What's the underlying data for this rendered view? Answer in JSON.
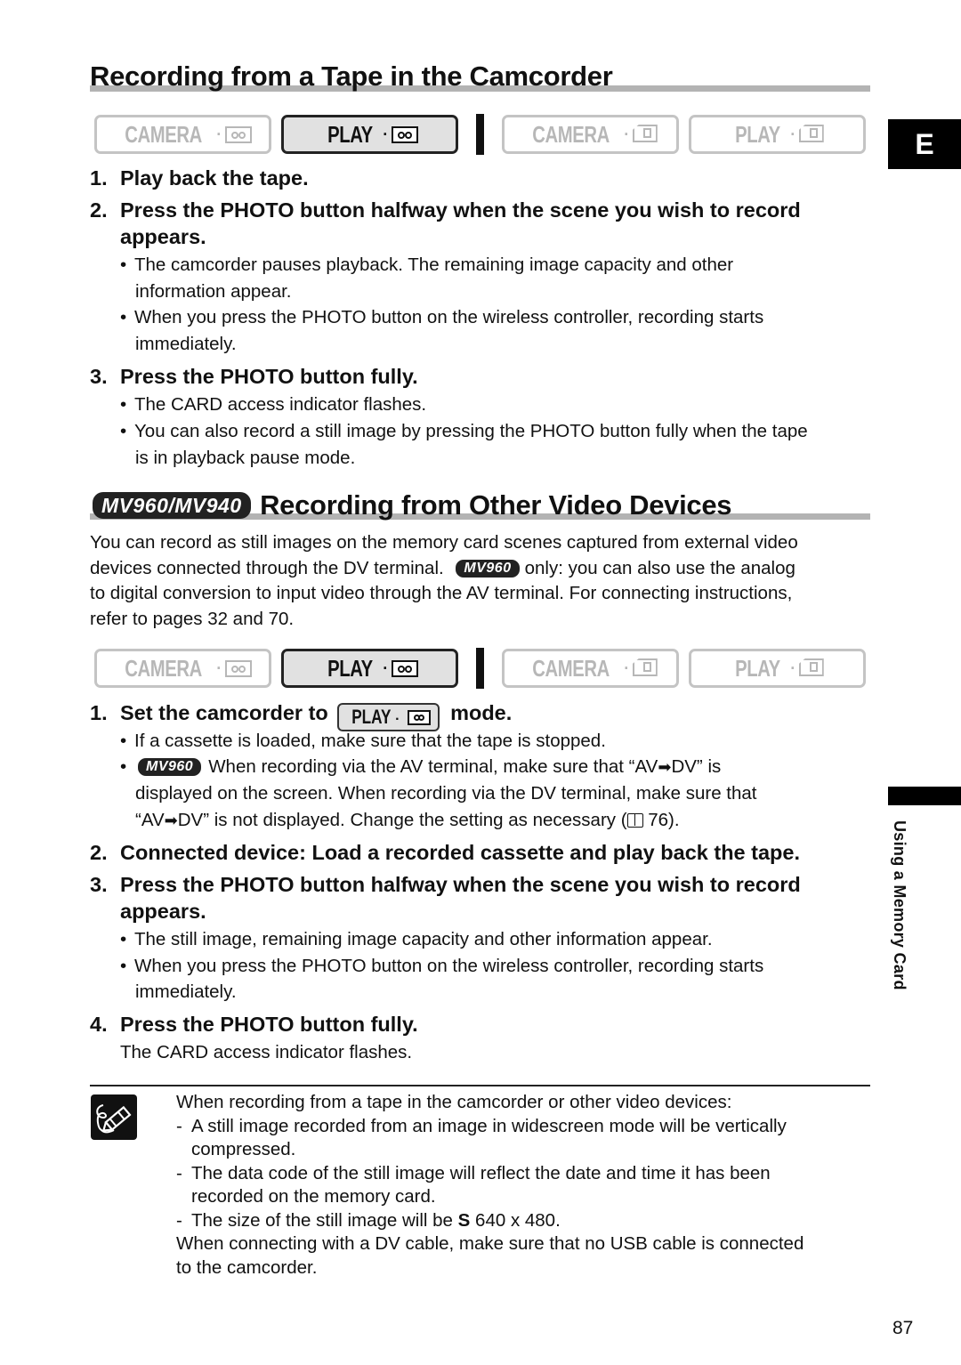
{
  "section1": {
    "title": "Recording from a Tape in the Camcorder",
    "mode_buttons": [
      {
        "label": "CAMERA",
        "icon": "tape-icon",
        "active": false
      },
      {
        "label": "PLAY",
        "icon": "tape-icon",
        "active": true
      },
      {
        "label": "CAMERA",
        "icon": "card-icon",
        "active": false
      },
      {
        "label": "PLAY",
        "icon": "card-icon",
        "active": false
      }
    ],
    "steps": [
      {
        "num": "1.",
        "text": "Play back the tape."
      },
      {
        "num": "2.",
        "text_line1": "Press the PHOTO button halfway when the scene you wish to record",
        "text_line2": "appears.",
        "bullets": [
          {
            "line1": "The camcorder pauses playback. The remaining image capacity and other",
            "line2": "information appear."
          },
          {
            "line1": "When you press the PHOTO button on the wireless controller, recording starts",
            "line2": "immediately."
          }
        ]
      },
      {
        "num": "3.",
        "text": "Press the PHOTO button fully.",
        "bullets": [
          {
            "line1": "The CARD access indicator flashes."
          },
          {
            "line1": "You can also record a still image by pressing the PHOTO button fully when the tape",
            "line2": "is in playback pause mode."
          }
        ]
      }
    ]
  },
  "section2": {
    "model_tag": "MV960/MV940",
    "title": "Recording from Other Video Devices",
    "intro": {
      "line1": "You can record as still images on the memory card scenes captured from external video",
      "line2_a": "devices connected through the DV terminal.",
      "line2_tag": "MV960",
      "line2_b": "only: you can also use the analog",
      "line3": "to digital conversion to input video through the AV terminal. For connecting instructions,",
      "line4": "refer to pages 32 and 70."
    },
    "mode_buttons": [
      {
        "label": "CAMERA",
        "icon": "tape-icon",
        "active": false
      },
      {
        "label": "PLAY",
        "icon": "tape-icon",
        "active": true
      },
      {
        "label": "CAMERA",
        "icon": "card-icon",
        "active": false
      },
      {
        "label": "PLAY",
        "icon": "card-icon",
        "active": false
      }
    ],
    "step1": {
      "num": "1.",
      "text_a": "Set the camcorder to",
      "mode_label": "PLAY",
      "text_b": "mode.",
      "bullet1": "If a cassette is loaded, make sure that the tape is stopped.",
      "bullet2": {
        "tag": "MV960",
        "line1_a": "When recording via the AV terminal, make sure that “AV",
        "line1_b": "DV” is",
        "line2": "displayed on the screen. When recording via the DV terminal, make sure that",
        "line3_a": "“AV",
        "line3_b": "DV” is not displayed. Change the setting as necessary (",
        "line3_c": " 76)."
      }
    },
    "step2": {
      "num": "2.",
      "text": "Connected device: Load a recorded cassette and play back the tape."
    },
    "step3": {
      "num": "3.",
      "text_line1": "Press the PHOTO button halfway when the scene you wish to record",
      "text_line2": "appears.",
      "bullet1": "The still image, remaining image capacity and other information appear.",
      "bullet2_line1": "When you press the PHOTO button on the wireless controller, recording starts",
      "bullet2_line2": "immediately."
    },
    "step4": {
      "num": "4.",
      "text": "Press the PHOTO button fully.",
      "sub": "The CARD access indicator flashes."
    }
  },
  "note": {
    "intro": "When recording from a tape in the camcorder or other video devices:",
    "items": [
      {
        "line1": "A still image recorded from an image in widescreen mode will be vertically",
        "line2": "compressed."
      },
      {
        "line1": "The data code of the still image will reflect the date and time it has been",
        "line2": "recorded on the memory card."
      }
    ],
    "size_item": {
      "a": "The size of the still image will be ",
      "bold": "S",
      "b": " 640 x 480."
    },
    "outro_line1": "When connecting with a DV cable, make sure that no USB cable is connected",
    "outro_line2": "to the camcorder."
  },
  "side": {
    "language_tab": "E",
    "chapter_label": "Using a Memory Card"
  },
  "page_number": "87",
  "symbols": {
    "bullet": "•",
    "dash": "-",
    "dot": "·",
    "arrow": "➡"
  }
}
